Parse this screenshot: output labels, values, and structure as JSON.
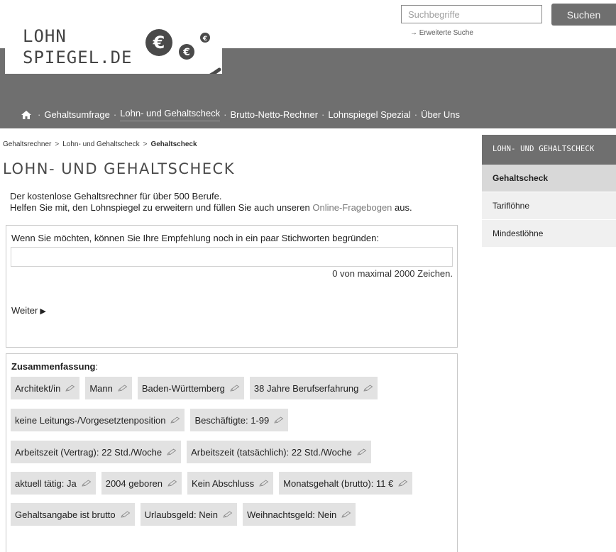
{
  "search": {
    "placeholder": "Suchbegriffe",
    "button_label": "Suchen",
    "advanced_label": "Erweiterte Suche"
  },
  "logo": {
    "line1": "LOHN",
    "line2": "SPIEGEL.DE"
  },
  "nav": {
    "items": [
      {
        "label": "Gehaltsumfrage"
      },
      {
        "label": "Lohn- und Gehaltscheck"
      },
      {
        "label": "Brutto-Netto-Rechner"
      },
      {
        "label": "Lohnspiegel Spezial"
      },
      {
        "label": "Über Uns"
      }
    ]
  },
  "breadcrumb": {
    "items": [
      "Gehaltsrechner",
      "Lohn- und Gehaltscheck",
      "Gehaltscheck"
    ]
  },
  "page_title": "LOHN- UND GEHALTSCHECK",
  "intro": {
    "line1": "Der kostenlose Gehaltsrechner für über 500 Berufe.",
    "line2_before": "Helfen Sie mit, den Lohnspiegel zu erweitern und füllen Sie auch unseren ",
    "line2_link": "Online-Fragebogen",
    "line2_after": " aus."
  },
  "form": {
    "question": "Wenn Sie möchten, können Sie Ihre Empfehlung noch in ein paar Stichworten begründen:",
    "textarea_value": "",
    "counter": "0 von maximal 2000 Zeichen.",
    "next_label": "Weiter"
  },
  "summary": {
    "title": "Zusammenfassung",
    "rows": [
      [
        "Architekt/in",
        "Mann",
        "Baden-Württemberg",
        "38 Jahre Berufserfahrung"
      ],
      [
        "keine Leitungs-/Vorgesetztenposition",
        "Beschäftigte: 1-99"
      ],
      [
        "Arbeitszeit (Vertrag): 22 Std./Woche",
        "Arbeitszeit (tatsächlich): 22 Std./Woche"
      ],
      [
        "aktuell tätig: Ja",
        "2004 geboren",
        "Kein Abschluss",
        "Monatsgehalt (brutto): 11 €"
      ],
      [
        "Gehaltsangabe ist brutto",
        "Urlaubsgeld: Nein",
        "Weihnachtsgeld: Nein"
      ]
    ]
  },
  "sidebar": {
    "heading": "LOHN- UND GEHALTSCHECK",
    "items": [
      {
        "label": "Gehaltscheck",
        "active": true
      },
      {
        "label": "Tariflöhne",
        "active": false
      },
      {
        "label": "Mindestlöhne",
        "active": false
      }
    ]
  },
  "colors": {
    "band": "#6f6f6f",
    "chip": "#e2e2e2",
    "sidebar_active": "#d8d8d8",
    "sidebar_item": "#f0f0f0",
    "link_muted": "#7a7a7a"
  }
}
